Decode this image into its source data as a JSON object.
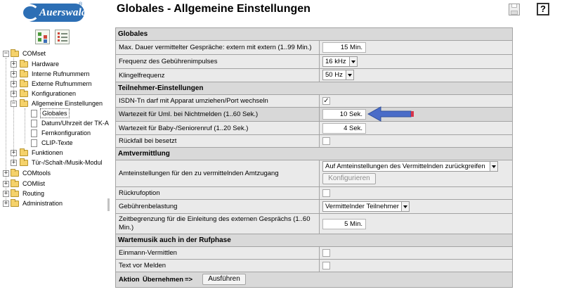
{
  "logo": {
    "brand": "Auerswald",
    "reg": "®"
  },
  "nav_buttons": [
    {
      "icon": "tree-view-icon"
    },
    {
      "icon": "list-view-icon"
    }
  ],
  "tree": {
    "items": [
      {
        "label": "COMset",
        "expanded": true
      },
      {
        "label": "Hardware"
      },
      {
        "label": "Interne Rufnummern"
      },
      {
        "label": "Externe Rufnummern"
      },
      {
        "label": "Konfigurationen"
      },
      {
        "label": "Allgemeine Einstellungen",
        "expanded": true
      },
      {
        "label": "Globales",
        "selected": true
      },
      {
        "label": "Datum/Uhrzeit der TK-A"
      },
      {
        "label": "Fernkonfiguration"
      },
      {
        "label": "CLIP-Texte"
      },
      {
        "label": "Funktionen"
      },
      {
        "label": "Tür-/Schalt-/Musik-Modul"
      },
      {
        "label": "COMtools"
      },
      {
        "label": "COMlist"
      },
      {
        "label": "Routing"
      },
      {
        "label": "Administration"
      }
    ]
  },
  "header": {
    "title": "Globales - Allgemeine Einstellungen",
    "help": "?"
  },
  "form": {
    "globales": {
      "heading": "Globales",
      "max_dauer": {
        "label": "Max. Dauer vermittelter Gespräche: extern mit extern (1..99 Min.)",
        "value": "15 Min."
      },
      "frequenz": {
        "label": "Frequenz des Gebührenimpulses",
        "value": "16 kHz"
      },
      "klingel": {
        "label": "Klingelfrequenz",
        "value": "50 Hz"
      }
    },
    "teilnehmer": {
      "heading": "Teilnehmer-Einstellungen",
      "isdn": {
        "label": "ISDN-Tn darf mit Apparat umziehen/Port wechseln",
        "checked": true,
        "mark": "✓"
      },
      "wartezeit_uml": {
        "label": "Wartezeit für Uml. bei Nichtmelden (1..60 Sek.)",
        "value": "10 Sek."
      },
      "wartezeit_baby": {
        "label": "Wartezeit für Baby-/Seniorenruf (1..20 Sek.)",
        "value": "4 Sek."
      },
      "rueckfall": {
        "label": "Rückfall bei besetzt",
        "checked": false
      }
    },
    "amt": {
      "heading": "Amtvermittlung",
      "amteinstellungen": {
        "label": "Amteinstellungen für den zu vermittelnden Amtzugang",
        "value": "Auf Amteinstellungen des Vermittelnden zurückgreifen",
        "button": "Konfigurieren"
      },
      "rueckrufoption": {
        "label": "Rückrufoption",
        "checked": false
      },
      "gebuehren": {
        "label": "Gebührenbelastung",
        "value": "Vermittelnder Teilnehmer"
      },
      "zeitbegrenzung": {
        "label": "Zeitbegrenzung für die Einleitung des externen Gesprächs (1..60 Min.)",
        "value": "5 Min."
      }
    },
    "musik": {
      "heading": "Wartemusik auch in der Rufphase",
      "einmann": {
        "label": "Einmann-Vermittlen",
        "checked": false
      },
      "textvor": {
        "label": "Text vor Melden",
        "checked": false
      }
    },
    "action": {
      "aktion": "Aktion",
      "uebernehmen": "Übernehmen",
      "arrow": "=>",
      "button": "Ausführen"
    }
  },
  "colors": {
    "accent_arrow": "#4a6cc8",
    "arrow_tip": "#d8344a",
    "section_bg": "#d9d9d9",
    "row_bg": "#eaeaea"
  }
}
